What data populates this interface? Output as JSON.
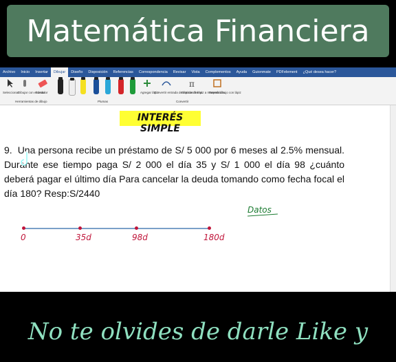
{
  "top_title": "Matemática Financiera",
  "ribbon": {
    "tabs": [
      "Archivo",
      "Inicio",
      "Insertar",
      "Dibujar",
      "Diseño",
      "Disposición",
      "Referencias",
      "Correspondencia",
      "Revisar",
      "Vista",
      "Complementos",
      "Ayuda",
      "Guionmate",
      "PDFelement",
      "¿Qué desea hacer?"
    ],
    "active_tab": "Dibujar",
    "tools": [
      "Seleccionar",
      "Dibujar con el dedo",
      "Borrador"
    ],
    "groups": [
      "Herramientas de dibujo",
      "Plumas",
      "Convertir"
    ],
    "actions": [
      "Agregar lápiz",
      "Convertir entrada de lápiz en forma",
      "Entrada de lápiz a matemáticas",
      "Repetir dibujo con lápiz"
    ]
  },
  "document": {
    "heading": "INTERÉS SIMPLE",
    "problem_number": "9.",
    "problem_text": "Una persona recibe un préstamo de S/ 5 000 por 6 meses al 2.5% mensual. Durante ese tiempo paga S/ 2 000 el día 35 y S/ 1 000 el día 98 ¿cuánto deberá pagar el último día Para cancelar la deuda tomando como fecha focal el día 180? Resp:S/2440",
    "datos_label": "Datos",
    "timeline_labels": [
      "0",
      "35d",
      "98d",
      "180d"
    ]
  },
  "bottom_text": "No te olvides de darle Like y",
  "colors": {
    "title_bg": "#4f7a5e",
    "ribbon_blue": "#2b579a",
    "highlight": "#ffff33",
    "ink_red": "#c0153a",
    "ink_green": "#1a7a30",
    "bottom_text": "#8fe0c0"
  },
  "icons": [
    "tiktok-icon",
    "pen-icon",
    "eraser-icon",
    "lasso-icon",
    "add-pen-icon",
    "math-icon"
  ]
}
